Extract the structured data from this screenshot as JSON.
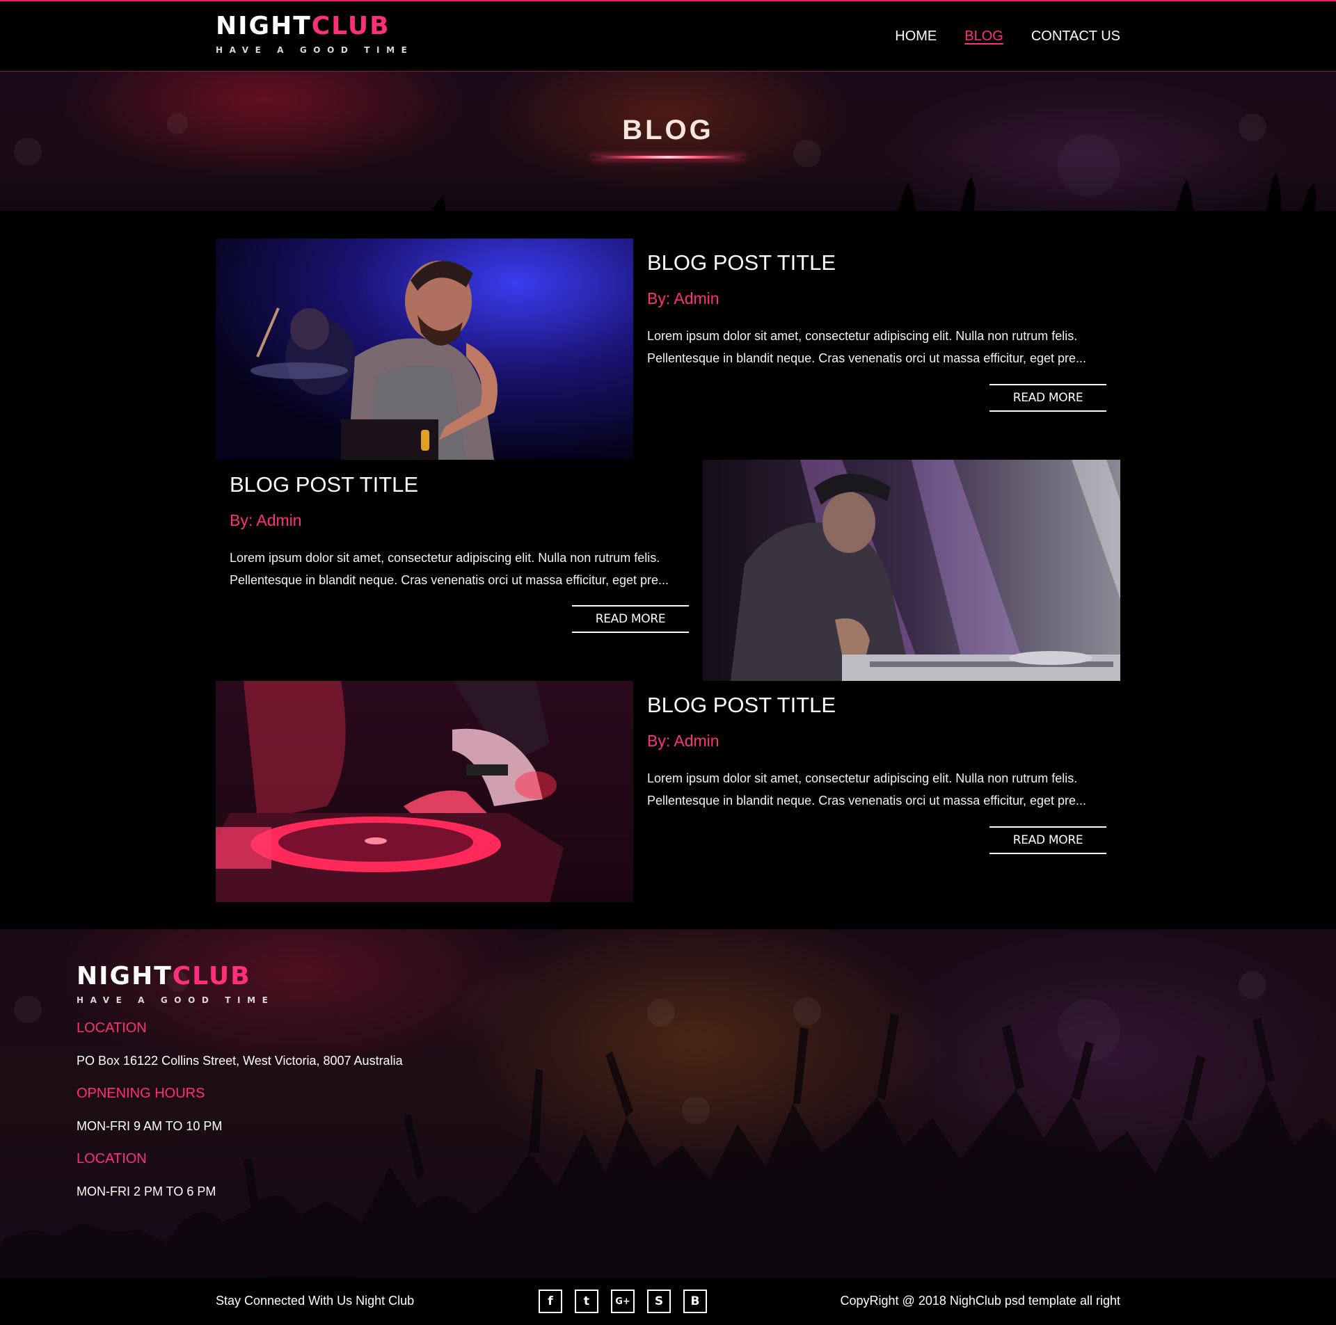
{
  "header": {
    "logo": {
      "brand_a": "NIGHT",
      "brand_b": "CLUB",
      "tagline": "HAVE A GOOD TIME"
    },
    "nav": {
      "home": "HOME",
      "blog": "BLOG",
      "contact": "CONTACT US",
      "active": "BLOG"
    }
  },
  "hero": {
    "title": "BLOG"
  },
  "posts": [
    {
      "title": "BLOG POST TITLE",
      "author": "By: Admin",
      "excerpt": "Lorem ipsum dolor sit amet, consectetur adipiscing elit. Nulla non rutrum felis. Pellentesque in blandit neque. Cras venenatis orci ut massa efficitur, eget pre...",
      "read_more": "READ MORE"
    },
    {
      "title": "BLOG POST TITLE",
      "author": "By: Admin",
      "excerpt": "Lorem ipsum dolor sit amet, consectetur adipiscing elit. Nulla non rutrum felis. Pellentesque in blandit neque. Cras venenatis orci ut massa efficitur, eget pre...",
      "read_more": "READ MORE"
    },
    {
      "title": "BLOG POST TITLE",
      "author": "By: Admin",
      "excerpt": "Lorem ipsum dolor sit amet, consectetur adipiscing elit. Nulla non rutrum felis. Pellentesque in blandit neque. Cras venenatis orci ut massa efficitur, eget pre...",
      "read_more": "READ MORE"
    }
  ],
  "footer": {
    "logo": {
      "brand_a": "NIGHT",
      "brand_b": "CLUB",
      "tagline": "HAVE A GOOD TIME"
    },
    "location_heading": "LOCATION",
    "address": "PO Box 16122 Collins Street, West Victoria, 8007 Australia",
    "hours_heading": "OPNENING HOURS",
    "hours": "MON-FRI 9 AM TO 10 PM",
    "location2_heading": "LOCATION",
    "hours2": "MON-FRI 2 PM TO 6 PM"
  },
  "bottom_bar": {
    "stay_connected": "Stay Connected With Us Night Club",
    "copyright": "CopyRight @ 2018 NighClub psd template all right",
    "socials": [
      {
        "icon": "facebook-icon",
        "glyph": "f"
      },
      {
        "icon": "twitter-icon",
        "glyph": "t"
      },
      {
        "icon": "google-plus-icon",
        "glyph": "G+"
      },
      {
        "icon": "skype-icon",
        "glyph": "S"
      },
      {
        "icon": "blogger-icon",
        "glyph": "B"
      }
    ]
  },
  "colors": {
    "accent": "#ff2f7a",
    "background": "#000000",
    "text": "#ffffff"
  }
}
